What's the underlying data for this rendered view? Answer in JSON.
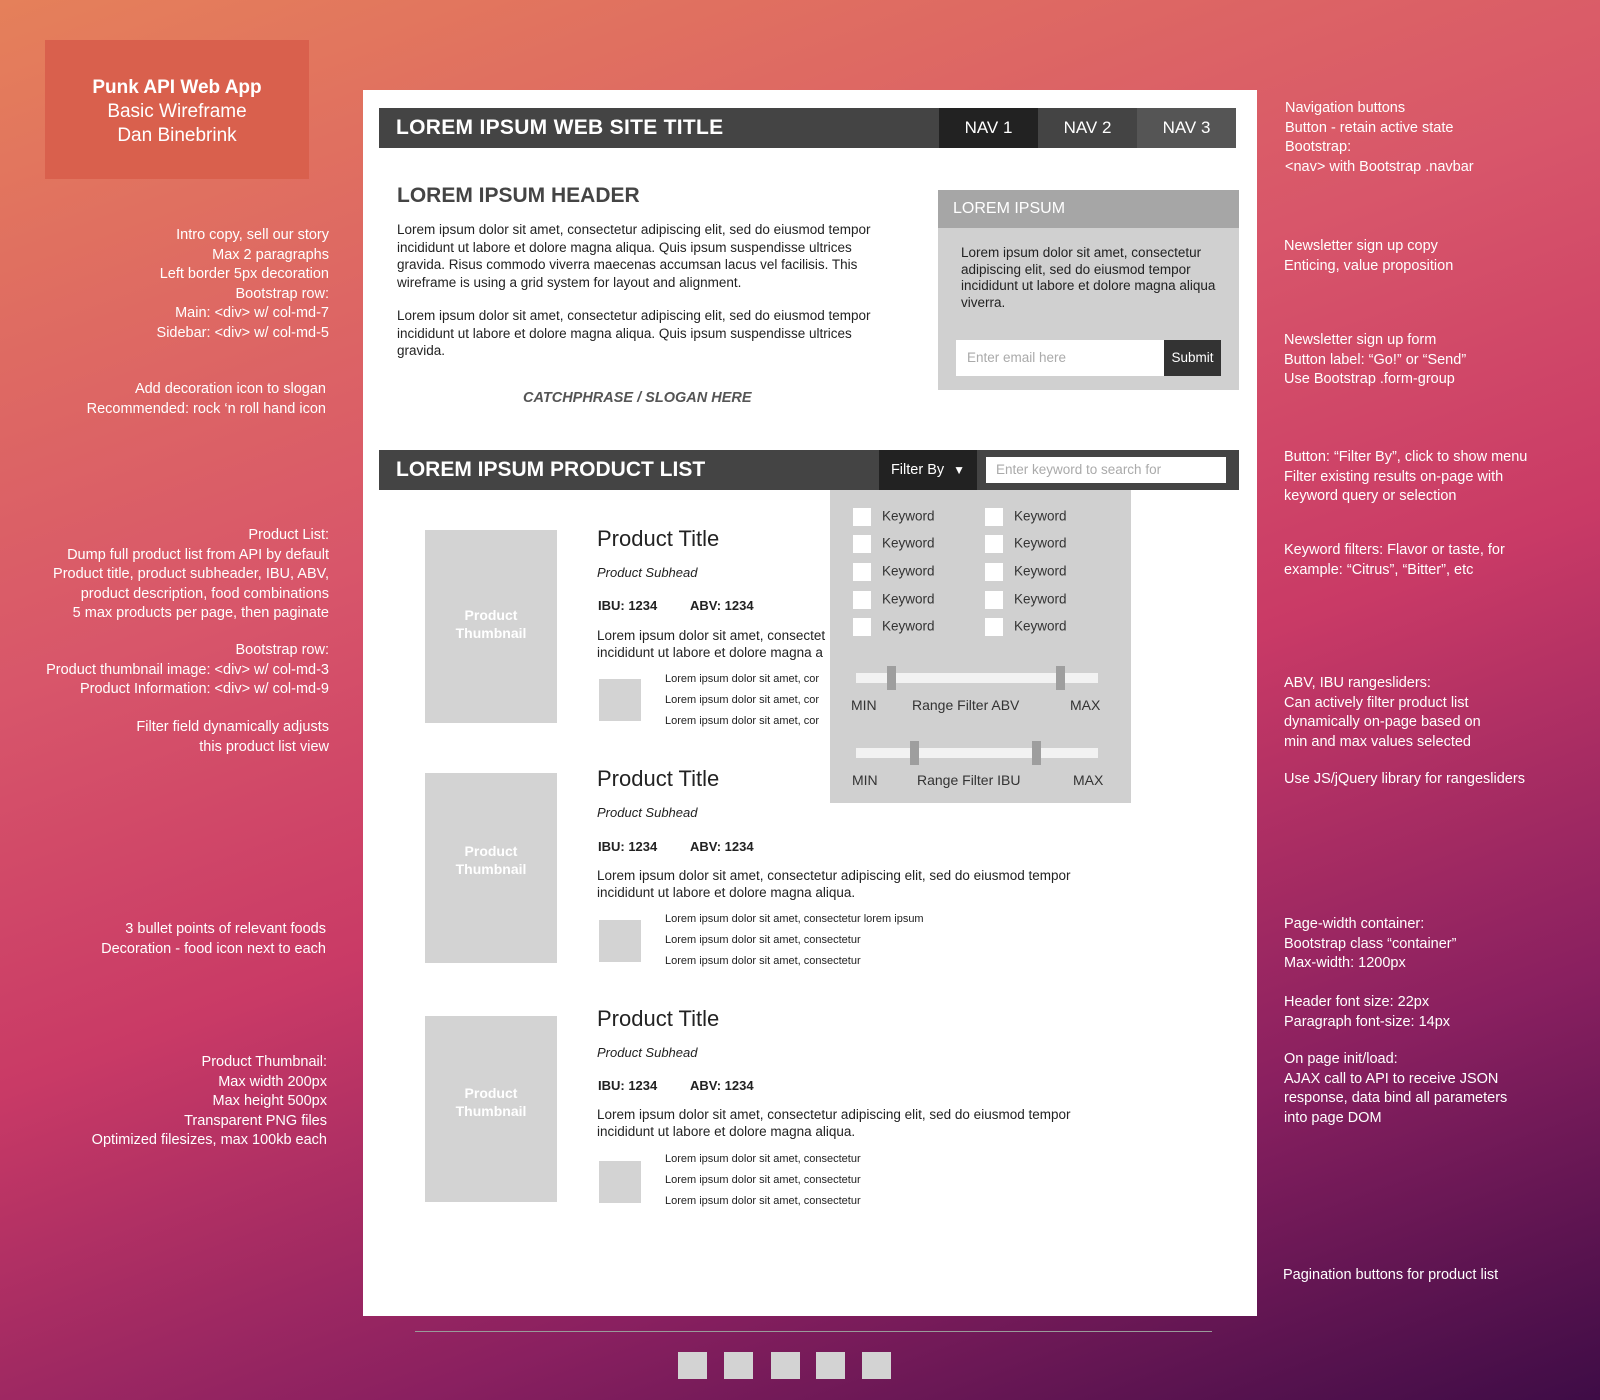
{
  "credit": {
    "line1": "Punk API Web App",
    "line2": "Basic Wireframe",
    "line3": "Dan Binebrink"
  },
  "left_notes": {
    "intro": "Intro copy, sell our story\nMax 2 paragraphs\nLeft border 5px decoration\nBootstrap row:\nMain: <div> w/ col-md-7\nSidebar: <div> w/ col-md-5",
    "slogan": "Add decoration icon to slogan\nRecommended: rock ‘n roll hand icon",
    "product_list": "Product List:\nDump full product list from API by default\nProduct title, product subheader, IBU, ABV,\nproduct description, food combinations\n5 max products per page, then paginate",
    "bootstrap_row": "Bootstrap row:\nProduct thumbnail image: <div> w/ col-md-3\nProduct Information: <div> w/ col-md-9",
    "filter_field": "Filter field dynamically adjusts\nthis product list view",
    "bullets": "3 bullet points of relevant foods\nDecoration - food icon next to each",
    "thumbnail": "Product Thumbnail:\nMax width 200px\nMax height 500px\nTransparent PNG files\nOptimized filesizes, max 100kb each"
  },
  "right_notes": {
    "nav": "Navigation buttons\nButton - retain active state\nBootstrap:\n<nav> with Bootstrap .navbar",
    "newsletter_copy": "Newsletter sign up copy\nEnticing, value proposition",
    "newsletter_form": "Newsletter sign up form\nButton label: “Go!” or “Send”\nUse Bootstrap .form-group",
    "filter_by": "Button: “Filter By”, click to show menu\nFilter existing results on-page with\nkeyword query or selection",
    "keyword_filters": "Keyword filters: Flavor or taste, for\nexample: “Citrus”, “Bitter”, etc",
    "rangesliders": "ABV, IBU rangesliders:\nCan actively filter product list\ndynamically on-page based on\nmin and max values selected",
    "jquery": "Use JS/jQuery library for rangesliders",
    "container": "Page-width container:\nBootstrap class “container”\nMax-width: 1200px",
    "fonts": "Header font size: 22px\nParagraph font-size: 14px",
    "init": "On page init/load:\nAJAX call to API to receive JSON\nresponse, data bind all parameters\ninto page DOM",
    "pagination": "Pagination buttons for product list"
  },
  "site": {
    "title": "LOREM IPSUM WEB SITE TITLE",
    "nav": [
      "NAV 1",
      "NAV 2",
      "NAV 3"
    ]
  },
  "intro": {
    "header": "LOREM IPSUM HEADER",
    "p1": "Lorem ipsum dolor sit amet, consectetur adipiscing elit, sed do eiusmod tempor incididunt ut labore et dolore magna aliqua. Quis ipsum suspendisse ultrices gravida. Risus commodo viverra maecenas accumsan lacus vel facilisis. This wireframe is using a grid system for layout and alignment.",
    "p2": "Lorem ipsum dolor sit amet, consectetur adipiscing elit, sed do eiusmod tempor incididunt ut labore et dolore magna aliqua. Quis ipsum suspendisse ultrices gravida.",
    "slogan": "CATCHPHRASE / SLOGAN HERE"
  },
  "sidebar": {
    "title": "LOREM IPSUM",
    "text": "Lorem ipsum dolor sit amet, consectetur adipiscing elit, sed do eiusmod tempor incididunt ut labore et dolore magna aliqua viverra.",
    "email_placeholder": "Enter email here",
    "submit": "Submit"
  },
  "product_list": {
    "title": "LOREM IPSUM PRODUCT LIST",
    "filter_label": "Filter By",
    "search_placeholder": "Enter keyword to search for"
  },
  "filter_menu": {
    "keywords_left": [
      "Keyword",
      "Keyword",
      "Keyword",
      "Keyword",
      "Keyword"
    ],
    "keywords_right": [
      "Keyword",
      "Keyword",
      "Keyword",
      "Keyword",
      "Keyword"
    ],
    "abv": {
      "min": "MIN",
      "label": "Range Filter ABV",
      "max": "MAX"
    },
    "ibu": {
      "min": "MIN",
      "label": "Range Filter IBU",
      "max": "MAX"
    }
  },
  "products": [
    {
      "thumb1": "Product",
      "thumb2": "Thumbnail",
      "title": "Product Title",
      "subhead": "Product Subhead",
      "ibu": "IBU: 1234",
      "abv": "ABV: 1234",
      "desc_line1": "Lorem ipsum dolor sit amet, consectet",
      "desc_line2": "incididunt ut labore et dolore magna a",
      "foods": [
        "Lorem ipsum dolor sit amet, cor",
        "Lorem ipsum dolor sit amet, cor",
        "Lorem ipsum dolor sit amet, cor"
      ]
    },
    {
      "thumb1": "Product",
      "thumb2": "Thumbnail",
      "title": "Product Title",
      "subhead": "Product Subhead",
      "ibu": "IBU: 1234",
      "abv": "ABV: 1234",
      "desc_line1": "Lorem ipsum dolor sit amet, consectetur adipiscing elit, sed do eiusmod tempor",
      "desc_line2": "incididunt ut labore et dolore magna aliqua.",
      "foods": [
        "Lorem ipsum dolor sit amet, consectetur lorem ipsum",
        "Lorem ipsum dolor sit amet, consectetur",
        "Lorem ipsum dolor sit amet, consectetur"
      ]
    },
    {
      "thumb1": "Product",
      "thumb2": "Thumbnail",
      "title": "Product Title",
      "subhead": "Product Subhead",
      "ibu": "IBU: 1234",
      "abv": "ABV: 1234",
      "desc_line1": "Lorem ipsum dolor sit amet, consectetur adipiscing elit, sed do eiusmod tempor",
      "desc_line2": "incididunt ut labore et dolore magna aliqua.",
      "foods": [
        "Lorem ipsum dolor sit amet, consectetur",
        "Lorem ipsum dolor sit amet, consectetur",
        "Lorem ipsum dolor sit amet, consectetur"
      ]
    }
  ]
}
